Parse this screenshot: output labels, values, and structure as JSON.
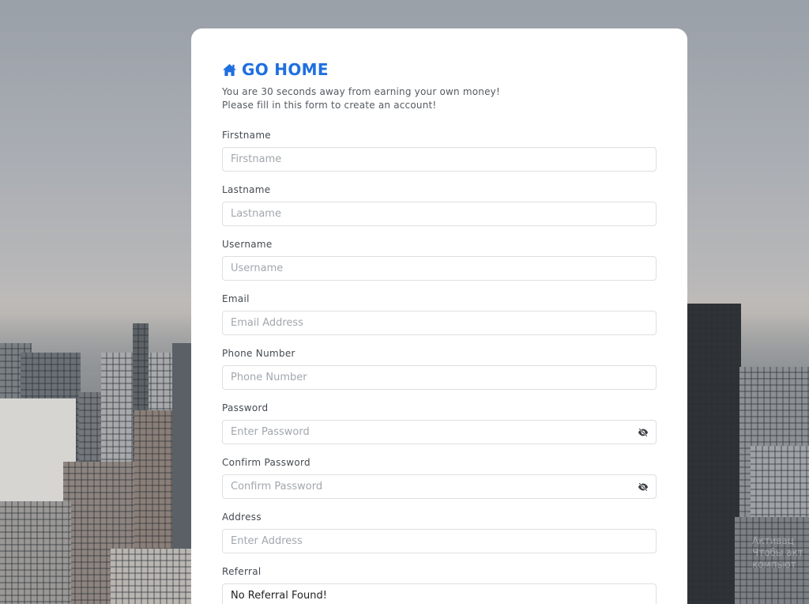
{
  "header": {
    "go_home_label": "GO HOME",
    "intro_line1": "You are 30 seconds away from earning your own money!",
    "intro_line2": "Please fill in this form to create an account!"
  },
  "form": {
    "firstname": {
      "label": "Firstname",
      "placeholder": "Firstname"
    },
    "lastname": {
      "label": "Lastname",
      "placeholder": "Lastname"
    },
    "username": {
      "label": "Username",
      "placeholder": "Username"
    },
    "email": {
      "label": "Email",
      "placeholder": "Email Address"
    },
    "phone": {
      "label": "Phone Number",
      "placeholder": "Phone Number"
    },
    "password": {
      "label": "Password",
      "placeholder": "Enter Password",
      "toggle_icon": "eye-slash-icon"
    },
    "confirm_password": {
      "label": "Confirm Password",
      "placeholder": "Confirm Password",
      "toggle_icon": "eye-slash-icon"
    },
    "address": {
      "label": "Address",
      "placeholder": "Enter Address"
    },
    "referral": {
      "label": "Referral",
      "value": "No Referral Found!"
    }
  },
  "watermark": {
    "line1": "Активац",
    "line2": "Чтобы акт",
    "line3": "компьют"
  },
  "colors": {
    "accent": "#1f6fe0",
    "card_bg": "#ffffff",
    "input_border": "#dcdfe3",
    "placeholder": "#a2a7ad"
  }
}
